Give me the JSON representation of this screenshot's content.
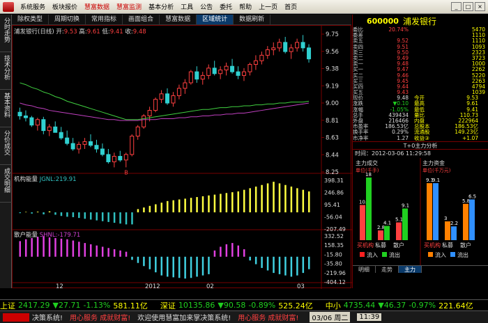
{
  "menu": [
    "系统服务",
    "板块报价",
    "慧富数据",
    "慧富监测",
    "基本分析",
    "工具",
    "公告",
    "委托",
    "帮助",
    "上一页",
    "首页"
  ],
  "menu_red": [
    2,
    3
  ],
  "toolbar": [
    "除权类型",
    "周期切换",
    "常用指标",
    "画面组合",
    "慧富数据",
    "区域统计",
    "数据刷新"
  ],
  "toolbar_active": 5,
  "left_tabs": [
    "分时走势",
    "技术分析",
    "基本资料",
    "分价成交",
    "成交明细"
  ],
  "panel1": {
    "title": "浦发银行(日线)",
    "open_label": "开:",
    "open": "9.53",
    "high_label": "高:",
    "high": "9.61",
    "low_label": "低:",
    "low": "9.41",
    "close_label": "收:",
    "close": "9.48"
  },
  "panel1_ticks": [
    "9.75",
    "9.56",
    "9.38",
    "9.19",
    "9.00",
    "8.81",
    "8.63",
    "8.44",
    "8.25"
  ],
  "panel2": {
    "title": "机构能量",
    "indicator": "JGNL:219.91"
  },
  "panel2_ticks": [
    "398.31",
    "246.86",
    "95.41",
    "-56.04",
    "-207.49"
  ],
  "panel3": {
    "title": "散户能量",
    "indicator": "SHNL:-179.71"
  },
  "panel3_ticks": [
    "332.52",
    "158.35",
    "-15.80",
    "-35.80",
    "-219.96",
    "-404.12"
  ],
  "xaxis": [
    "12",
    "2012",
    "02",
    "03"
  ],
  "markers": {
    "buy": "B"
  },
  "quote": {
    "code": "600000",
    "name": "浦发银行",
    "rows": [
      [
        "委比",
        "20.74%",
        "5470"
      ],
      [
        "委差",
        "",
        "1110"
      ],
      [
        "卖五",
        "9.52",
        "1110"
      ],
      [
        "卖四",
        "9.51",
        "1093"
      ],
      [
        "卖三",
        "9.50",
        "2323"
      ],
      [
        "卖二",
        "9.49",
        "3723"
      ],
      [
        "卖一",
        "9.48",
        "1000"
      ],
      [
        "买一",
        "9.47",
        "2262"
      ],
      [
        "买二",
        "9.46",
        "5220"
      ],
      [
        "买三",
        "9.45",
        "2263"
      ],
      [
        "买四",
        "9.44",
        "4794"
      ],
      [
        "买五",
        "9.43",
        "1039"
      ],
      [
        "现价",
        "9.48",
        "今开"
      ],
      [
        "涨跌",
        "▼0.10",
        "最高"
      ],
      [
        "涨幅",
        "-1.05%",
        "最低"
      ],
      [
        "总手",
        "439434",
        "量比"
      ],
      [
        "外盘",
        "216466",
        "内盘"
      ],
      [
        "市盈率",
        "186.53亿",
        "总股本"
      ],
      [
        "换手率",
        "0.29%",
        "流通股"
      ],
      [
        "市净率",
        "1.27",
        "收益③"
      ]
    ],
    "right_values": [
      "9.53",
      "9.61",
      "9.41",
      "110.73",
      "222964",
      "186.53亿",
      "149.23亿",
      "+1.07"
    ]
  },
  "t0": "T+0主力分析",
  "time_label": "时间：2012-03-06 11:29:58",
  "sub_titles": [
    "主力成交",
    "主力资金"
  ],
  "units": [
    "单位(千手)",
    "单位(千万元)"
  ],
  "bar_labels_left": [
    "买机构",
    "私募",
    "散户"
  ],
  "bar_labels_right": [
    "买机构",
    "私募",
    "散户"
  ],
  "legend": [
    "流入",
    "流出",
    "流入",
    "流出"
  ],
  "bottom_tabs": [
    "明细",
    "走势",
    "主力"
  ],
  "ticker": [
    {
      "k": "上证",
      "v": "2417.29",
      "d": "▼27.71",
      "p": "-1.13%",
      "a": "581.11亿"
    },
    {
      "k": "深证",
      "v": "10135.86",
      "d": "▼90.58",
      "p": "-0.89%",
      "a": "525.24亿"
    },
    {
      "k": "中小",
      "v": "4735.44",
      "d": "▼46.37",
      "p": "-0.97%",
      "a": "221.64亿"
    }
  ],
  "status": [
    "决策系统!",
    "用心服务 成就财富!",
    "欢迎使用慧富加来掌决策系统!",
    "用心服务 成就财富!",
    "03/06 周二",
    "11:39"
  ],
  "chart_data": {
    "type": "candlestick",
    "title": "浦发银行(日线)",
    "ylim": [
      8.25,
      9.75
    ],
    "candles": [
      [
        8.9,
        8.95,
        8.82,
        8.86
      ],
      [
        8.86,
        8.92,
        8.8,
        8.84
      ],
      [
        8.84,
        8.86,
        8.74,
        8.76
      ],
      [
        8.76,
        8.84,
        8.7,
        8.82
      ],
      [
        8.82,
        8.85,
        8.66,
        8.7
      ],
      [
        8.7,
        8.77,
        8.64,
        8.74
      ],
      [
        8.74,
        8.8,
        8.68,
        8.68
      ],
      [
        8.68,
        8.74,
        8.6,
        8.62
      ],
      [
        8.62,
        8.7,
        8.54,
        8.56
      ],
      [
        8.56,
        8.62,
        8.48,
        8.5
      ],
      [
        8.5,
        8.58,
        8.45,
        8.55
      ],
      [
        8.55,
        8.62,
        8.5,
        8.58
      ],
      [
        8.58,
        8.66,
        8.52,
        8.54
      ],
      [
        8.54,
        8.6,
        8.46,
        8.5
      ],
      [
        8.5,
        8.56,
        8.42,
        8.44
      ],
      [
        8.44,
        8.5,
        8.34,
        8.36
      ],
      [
        8.36,
        8.46,
        8.3,
        8.42
      ],
      [
        8.42,
        8.48,
        8.36,
        8.38
      ],
      [
        8.38,
        8.46,
        8.3,
        8.44
      ],
      [
        8.44,
        8.66,
        8.42,
        8.64
      ],
      [
        8.64,
        8.76,
        8.6,
        8.74
      ],
      [
        8.74,
        8.88,
        8.72,
        8.86
      ],
      [
        8.86,
        8.96,
        8.8,
        8.92
      ],
      [
        8.92,
        9.06,
        8.9,
        9.04
      ],
      [
        9.04,
        9.14,
        9.0,
        9.1
      ],
      [
        9.1,
        9.16,
        8.98,
        9.0
      ],
      [
        9.0,
        9.12,
        8.96,
        9.08
      ],
      [
        9.08,
        9.2,
        9.04,
        9.16
      ],
      [
        9.16,
        9.26,
        9.1,
        9.22
      ],
      [
        9.22,
        9.36,
        9.2,
        9.34
      ],
      [
        9.34,
        9.4,
        9.22,
        9.26
      ],
      [
        9.26,
        9.34,
        9.2,
        9.3
      ],
      [
        9.3,
        9.42,
        9.26,
        9.38
      ],
      [
        9.38,
        9.46,
        9.3,
        9.32
      ],
      [
        9.32,
        9.4,
        9.26,
        9.36
      ],
      [
        9.36,
        9.44,
        9.3,
        9.4
      ],
      [
        9.4,
        9.48,
        9.32,
        9.34
      ],
      [
        9.34,
        9.4,
        9.26,
        9.3
      ],
      [
        9.3,
        9.38,
        9.24,
        9.34
      ],
      [
        9.34,
        9.44,
        9.3,
        9.42
      ],
      [
        9.42,
        9.52,
        9.36,
        9.46
      ],
      [
        9.46,
        9.56,
        9.42,
        9.52
      ],
      [
        9.52,
        9.62,
        9.48,
        9.58
      ],
      [
        9.58,
        9.66,
        9.52,
        9.6
      ],
      [
        9.6,
        9.7,
        9.56,
        9.66
      ],
      [
        9.66,
        9.72,
        9.54,
        9.56
      ],
      [
        9.56,
        9.64,
        9.48,
        9.6
      ],
      [
        9.6,
        9.7,
        9.56,
        9.66
      ],
      [
        9.66,
        9.74,
        9.56,
        9.6
      ],
      [
        9.6,
        9.64,
        9.44,
        9.48
      ]
    ],
    "ma_green": [
      9.22,
      9.2,
      9.17,
      9.15,
      9.12,
      9.1,
      9.07,
      9.05,
      9.02,
      9.0,
      8.98,
      8.96,
      8.94,
      8.92,
      8.9,
      8.88,
      8.86,
      8.84,
      8.82,
      8.82,
      8.82,
      8.83,
      8.84,
      8.85,
      8.86,
      8.87,
      8.88,
      8.89,
      8.9,
      8.91,
      8.92,
      8.93,
      8.93,
      8.94,
      8.95,
      8.95,
      8.96,
      8.96,
      8.97,
      8.97,
      8.98,
      8.98,
      8.99,
      8.99,
      9.0,
      9.0,
      9.01,
      9.01,
      9.01,
      9.02
    ],
    "ma_purple": [
      9.0,
      8.98,
      8.97,
      8.95,
      8.94,
      8.92,
      8.91,
      8.9,
      8.89,
      8.88,
      8.87,
      8.86,
      8.85,
      8.84,
      8.83,
      8.82,
      8.82,
      8.81,
      8.81,
      8.81,
      8.81,
      8.82,
      8.82,
      8.82,
      8.83,
      8.83,
      8.83,
      8.84,
      8.84,
      8.85,
      8.85,
      8.86,
      8.86,
      8.87,
      8.87,
      8.88,
      8.88,
      8.89,
      8.89,
      8.9,
      8.91,
      8.92,
      8.93,
      8.94,
      8.95,
      8.96,
      8.97,
      8.98,
      8.99,
      9.0
    ],
    "jgnl": [
      -10,
      5,
      -15,
      8,
      -25,
      12,
      -30,
      -45,
      -55,
      -60,
      -70,
      -80,
      -90,
      -100,
      -110,
      -120,
      -130,
      -140,
      -150,
      -150,
      40,
      60,
      80,
      100,
      120,
      140,
      150,
      160,
      170,
      180,
      190,
      200,
      210,
      220,
      230,
      240,
      250,
      260,
      280,
      300,
      320,
      340,
      360,
      380,
      360,
      340,
      320,
      300,
      280,
      260
    ],
    "jgnl_lim": [
      -207.49,
      398.31
    ],
    "shnl": [
      250,
      280,
      300,
      320,
      330,
      310,
      300,
      290,
      280,
      260,
      240,
      220,
      200,
      180,
      160,
      140,
      120,
      100,
      80,
      -50,
      -100,
      -150,
      -200,
      -250,
      -300,
      -320,
      -330,
      -340,
      -350,
      -340,
      -320,
      -300,
      -280,
      100,
      160,
      200,
      220,
      180,
      120,
      -60,
      -120,
      -180,
      -220,
      -260,
      -280,
      -300,
      -320,
      -300,
      -260,
      -200
    ],
    "shnl_lim": [
      -404.12,
      332.52
    ],
    "bars_left": [
      {
        "v": 10.1,
        "c": "#ff4040"
      },
      {
        "v": 18,
        "c": "#20d020"
      },
      {
        "v": 2.8,
        "c": "#ff4040"
      },
      {
        "v": 4.1,
        "c": "#20d020"
      },
      {
        "v": 5.1,
        "c": "#ff4040"
      },
      {
        "v": 9.1,
        "c": "#20d020"
      }
    ],
    "bars_right": [
      {
        "v": 9.1,
        "c": "#ff8000"
      },
      {
        "v": 9.1,
        "c": "#3090ff"
      },
      {
        "v": 3.0,
        "c": "#ff8000"
      },
      {
        "v": 2.2,
        "c": "#3090ff"
      },
      {
        "v": 5.8,
        "c": "#ff8000"
      },
      {
        "v": 6.5,
        "c": "#3090ff"
      }
    ]
  }
}
